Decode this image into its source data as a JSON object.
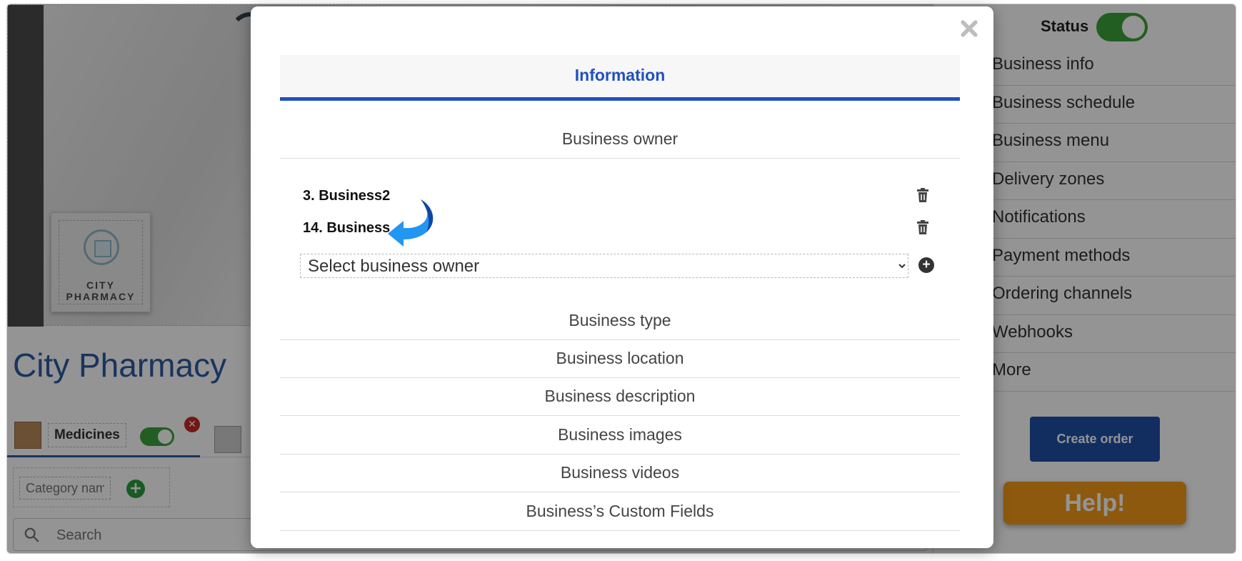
{
  "page": {
    "business_name": "City Pharmacy",
    "logo_text": "CITY\nPHARMACY",
    "category": {
      "name": "Medicines",
      "enabled": true
    },
    "new_category_placeholder": "Category name",
    "search_placeholder": "Search"
  },
  "right_panel": {
    "status_label": "Status",
    "status_enabled": true,
    "menu": [
      "Business info",
      "Business schedule",
      "Business menu",
      "Delivery zones",
      "Notifications",
      "Payment methods",
      "Ordering channels",
      "Webhooks",
      "More"
    ],
    "create_order_label": "Create order",
    "help_label": "Help!"
  },
  "modal": {
    "close_icon": "close-icon",
    "tab_label": "Information",
    "sections": {
      "owner": "Business owner",
      "type": "Business type",
      "location": "Business location",
      "description": "Business description",
      "images": "Business images",
      "videos": "Business videos",
      "custom_fields": "Business’s Custom Fields"
    },
    "owners": [
      "3. Business2",
      "14. Business"
    ],
    "select_owner_placeholder": "Select business owner",
    "colors": {
      "accent": "#2050c0",
      "arrow": "#2196f3",
      "toggle_on": "#3ba33b",
      "help": "#f29a19"
    }
  }
}
